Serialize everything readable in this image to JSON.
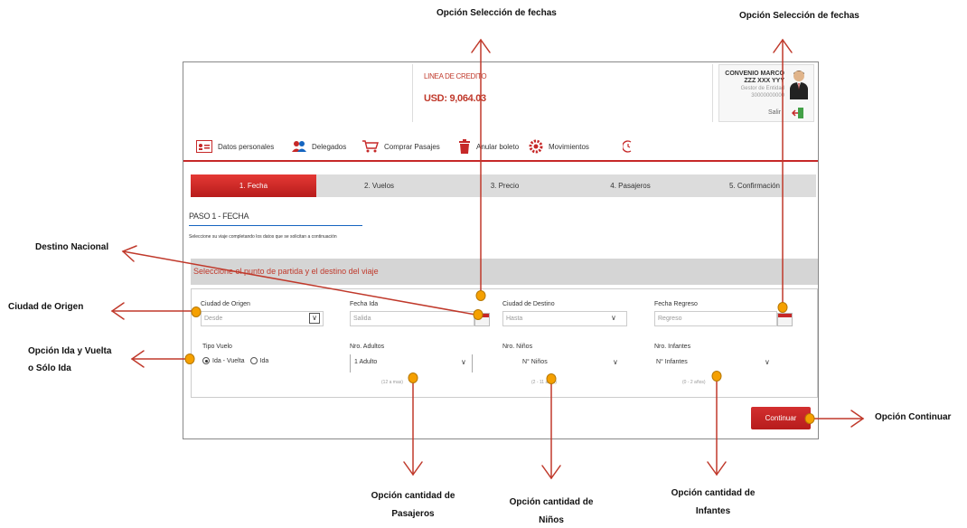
{
  "header": {
    "credit_label": "LINEA DE CREDITO",
    "credit_amount": "USD: 9,064.03",
    "user_line1": "CONVENIO MARCO",
    "user_line2": "ZZZ XXX YYY",
    "user_line3": "Gestor de Entidad",
    "user_line4": "30000000000",
    "logout_label": "Salir"
  },
  "nav": {
    "items": [
      {
        "label": "Datos personales",
        "icon": "user-card-icon"
      },
      {
        "label": "Delegados",
        "icon": "users-icon"
      },
      {
        "label": "Comprar Pasajes",
        "icon": "cart-icon"
      },
      {
        "label": "Anular boleto",
        "icon": "trash-icon"
      },
      {
        "label": "Movimientos",
        "icon": "gear-icon"
      }
    ]
  },
  "steps": [
    "1. Fecha",
    "2. Vuelos",
    "3. Precio",
    "4. Pasajeros",
    "5. Confirmación"
  ],
  "form": {
    "step_title": "PASO 1 - FECHA",
    "instructions": "Seleccione su viaje completando los datos que se solicitan a continuación",
    "section_title": "Seleccione el punto de partida y el destino del viaje",
    "origin_label": "Ciudad de Origen",
    "origin_placeholder": "Desde",
    "depart_label": "Fecha Ida",
    "depart_placeholder": "Salida",
    "dest_label": "Ciudad de Destino",
    "dest_placeholder": "Hasta",
    "return_label": "Fecha Regreso",
    "return_placeholder": "Regreso",
    "trip_label": "Tipo Vuelo",
    "trip_roundtrip": "Ida - Vuelta",
    "trip_oneway": "Ida",
    "adults_label": "Nro. Adultos",
    "adults_value": "1 Adulto",
    "adults_hint": "(12 a mas)",
    "children_label": "Nro. Niños",
    "children_value": "N° Niños",
    "children_hint": "(2 - 11 años)",
    "infants_label": "Nro. Infantes",
    "infants_value": "N° Infantes",
    "infants_hint": "(0 - 2 años)",
    "continue_label": "Continuar"
  },
  "annotations": {
    "dates_top_a": "Opción Selección de fechas",
    "dates_top_b": "Opción Selección de fechas",
    "destino": "Destino Nacional",
    "origen": "Ciudad de Origen",
    "tipo_l1": "Opción Ida y Vuelta",
    "tipo_l2": "o Sólo Ida",
    "continuar": "Opción Continuar",
    "pasajeros_l1": "Opción cantidad de",
    "pasajeros_l2": "Pasajeros",
    "ninos_l1": "Opción cantidad de",
    "ninos_l2": "Niños",
    "infantes_l1": "Opción cantidad de",
    "infantes_l2": "Infantes"
  },
  "colors": {
    "accent_red": "#c62828",
    "marker_orange": "#f5a000",
    "arrow": "#c0392b"
  }
}
